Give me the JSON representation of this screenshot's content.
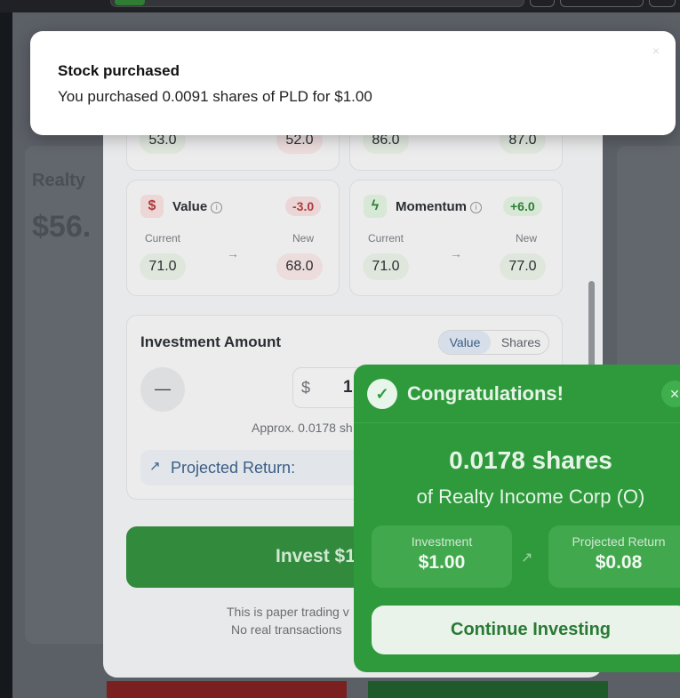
{
  "toast": {
    "title": "Stock purchased",
    "message": "You purchased 0.0091 shares of PLD for $1.00",
    "close": "×"
  },
  "background": {
    "ghost_name": "Realty",
    "ghost_price": "$56."
  },
  "metrics_top": {
    "left_current": "53.0",
    "left_new": "52.0",
    "right_current": "86.0",
    "right_new": "87.0"
  },
  "metrics": [
    {
      "name": "Value",
      "icon": "$",
      "delta": "-3.0",
      "current_label": "Current",
      "new_label": "New",
      "current": "71.0",
      "new": "68.0"
    },
    {
      "name": "Momentum",
      "icon": "ϟ",
      "delta": "+6.0",
      "current_label": "Current",
      "new_label": "New",
      "current": "71.0",
      "new": "77.0"
    }
  ],
  "investment": {
    "title": "Investment Amount",
    "mode_value": "Value",
    "mode_shares": "Shares",
    "minus": "—",
    "currency": "$",
    "amount": "1",
    "approx": "Approx. 0.0178 sh",
    "projected_label": "Projected Return:",
    "invest_button": "Invest $1",
    "disclaimer_1": "This is paper trading v",
    "disclaimer_2": "No real transactions"
  },
  "congrats": {
    "title": "Congratulations!",
    "shares": "0.0178 shares",
    "company": "of Realty Income Corp (O)",
    "investment_label": "Investment",
    "investment_value": "$1.00",
    "return_label": "Projected Return",
    "return_value": "$0.08",
    "continue_button": "Continue Investing"
  },
  "colors": {
    "congrats_green": "#2f9a3c",
    "negative": "#b03a3a",
    "positive": "#2c7d36"
  }
}
